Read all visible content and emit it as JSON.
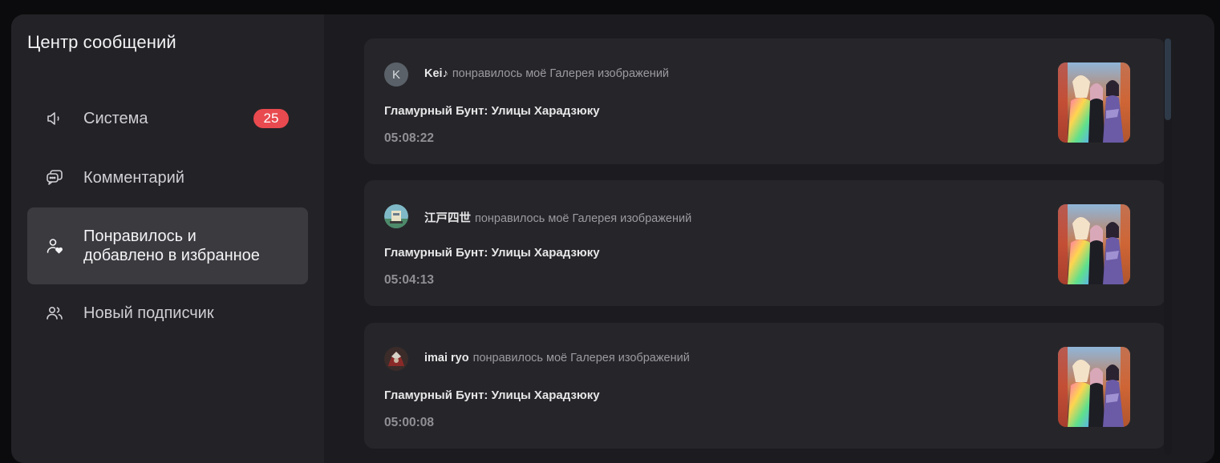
{
  "sidebar": {
    "title": "Центр сообщений",
    "items": [
      {
        "label": "Система",
        "badge": "25",
        "icon": "speaker-icon"
      },
      {
        "label": "Комментарий",
        "icon": "chat-bubbles-icon"
      },
      {
        "label": "Понравилось и\nдобавлено в избранное",
        "icon": "user-heart-icon",
        "active": true
      },
      {
        "label": "Новый подписчик",
        "icon": "users-icon"
      }
    ]
  },
  "notifications": [
    {
      "user": "Kei♪",
      "avatar_letter": "K",
      "action": "понравилось моё Галерея изображений",
      "title": "Гламурный Бунт: Улицы Харадзюку",
      "time": "05:08:22"
    },
    {
      "user": "江戸四世",
      "action": "понравилось моё Галерея изображений",
      "title": "Гламурный Бунт: Улицы Харадзюку",
      "time": "05:04:13"
    },
    {
      "user": "imai ryo",
      "action": "понравилось моё Галерея изображений",
      "title": "Гламурный Бунт: Улицы Харадзюку",
      "time": "05:00:08"
    }
  ],
  "colors": {
    "badge": "#e84a4f",
    "active_bg": "#3a3a3f",
    "card_bg": "#26262a"
  }
}
